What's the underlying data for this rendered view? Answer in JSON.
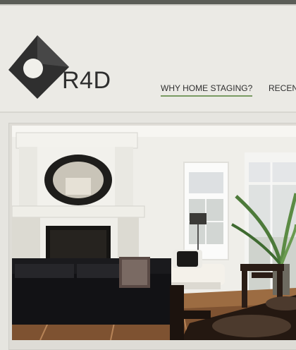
{
  "site": {
    "logo_text": "R4D"
  },
  "nav": {
    "items": [
      {
        "label": "WHY HOME STAGING?",
        "active": true
      },
      {
        "label": "RECEN",
        "active": false
      }
    ]
  },
  "colors": {
    "accent": "#7a9b63",
    "header_bg": "#ebeae5",
    "dark_text": "#2e2e2e"
  },
  "hero": {
    "image": "staged-living-room"
  }
}
